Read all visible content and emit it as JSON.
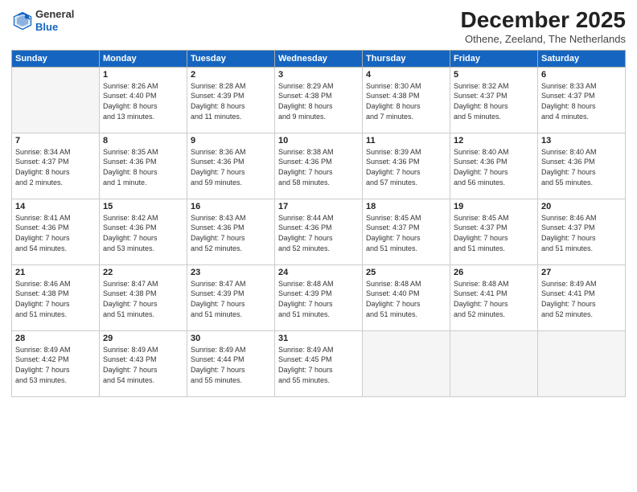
{
  "header": {
    "logo_line1": "General",
    "logo_line2": "Blue",
    "month": "December 2025",
    "location": "Othene, Zeeland, The Netherlands"
  },
  "days_of_week": [
    "Sunday",
    "Monday",
    "Tuesday",
    "Wednesday",
    "Thursday",
    "Friday",
    "Saturday"
  ],
  "weeks": [
    [
      {
        "day": "",
        "info": ""
      },
      {
        "day": "1",
        "info": "Sunrise: 8:26 AM\nSunset: 4:40 PM\nDaylight: 8 hours\nand 13 minutes."
      },
      {
        "day": "2",
        "info": "Sunrise: 8:28 AM\nSunset: 4:39 PM\nDaylight: 8 hours\nand 11 minutes."
      },
      {
        "day": "3",
        "info": "Sunrise: 8:29 AM\nSunset: 4:38 PM\nDaylight: 8 hours\nand 9 minutes."
      },
      {
        "day": "4",
        "info": "Sunrise: 8:30 AM\nSunset: 4:38 PM\nDaylight: 8 hours\nand 7 minutes."
      },
      {
        "day": "5",
        "info": "Sunrise: 8:32 AM\nSunset: 4:37 PM\nDaylight: 8 hours\nand 5 minutes."
      },
      {
        "day": "6",
        "info": "Sunrise: 8:33 AM\nSunset: 4:37 PM\nDaylight: 8 hours\nand 4 minutes."
      }
    ],
    [
      {
        "day": "7",
        "info": "Sunrise: 8:34 AM\nSunset: 4:37 PM\nDaylight: 8 hours\nand 2 minutes."
      },
      {
        "day": "8",
        "info": "Sunrise: 8:35 AM\nSunset: 4:36 PM\nDaylight: 8 hours\nand 1 minute."
      },
      {
        "day": "9",
        "info": "Sunrise: 8:36 AM\nSunset: 4:36 PM\nDaylight: 7 hours\nand 59 minutes."
      },
      {
        "day": "10",
        "info": "Sunrise: 8:38 AM\nSunset: 4:36 PM\nDaylight: 7 hours\nand 58 minutes."
      },
      {
        "day": "11",
        "info": "Sunrise: 8:39 AM\nSunset: 4:36 PM\nDaylight: 7 hours\nand 57 minutes."
      },
      {
        "day": "12",
        "info": "Sunrise: 8:40 AM\nSunset: 4:36 PM\nDaylight: 7 hours\nand 56 minutes."
      },
      {
        "day": "13",
        "info": "Sunrise: 8:40 AM\nSunset: 4:36 PM\nDaylight: 7 hours\nand 55 minutes."
      }
    ],
    [
      {
        "day": "14",
        "info": "Sunrise: 8:41 AM\nSunset: 4:36 PM\nDaylight: 7 hours\nand 54 minutes."
      },
      {
        "day": "15",
        "info": "Sunrise: 8:42 AM\nSunset: 4:36 PM\nDaylight: 7 hours\nand 53 minutes."
      },
      {
        "day": "16",
        "info": "Sunrise: 8:43 AM\nSunset: 4:36 PM\nDaylight: 7 hours\nand 52 minutes."
      },
      {
        "day": "17",
        "info": "Sunrise: 8:44 AM\nSunset: 4:36 PM\nDaylight: 7 hours\nand 52 minutes."
      },
      {
        "day": "18",
        "info": "Sunrise: 8:45 AM\nSunset: 4:37 PM\nDaylight: 7 hours\nand 51 minutes."
      },
      {
        "day": "19",
        "info": "Sunrise: 8:45 AM\nSunset: 4:37 PM\nDaylight: 7 hours\nand 51 minutes."
      },
      {
        "day": "20",
        "info": "Sunrise: 8:46 AM\nSunset: 4:37 PM\nDaylight: 7 hours\nand 51 minutes."
      }
    ],
    [
      {
        "day": "21",
        "info": "Sunrise: 8:46 AM\nSunset: 4:38 PM\nDaylight: 7 hours\nand 51 minutes."
      },
      {
        "day": "22",
        "info": "Sunrise: 8:47 AM\nSunset: 4:38 PM\nDaylight: 7 hours\nand 51 minutes."
      },
      {
        "day": "23",
        "info": "Sunrise: 8:47 AM\nSunset: 4:39 PM\nDaylight: 7 hours\nand 51 minutes."
      },
      {
        "day": "24",
        "info": "Sunrise: 8:48 AM\nSunset: 4:39 PM\nDaylight: 7 hours\nand 51 minutes."
      },
      {
        "day": "25",
        "info": "Sunrise: 8:48 AM\nSunset: 4:40 PM\nDaylight: 7 hours\nand 51 minutes."
      },
      {
        "day": "26",
        "info": "Sunrise: 8:48 AM\nSunset: 4:41 PM\nDaylight: 7 hours\nand 52 minutes."
      },
      {
        "day": "27",
        "info": "Sunrise: 8:49 AM\nSunset: 4:41 PM\nDaylight: 7 hours\nand 52 minutes."
      }
    ],
    [
      {
        "day": "28",
        "info": "Sunrise: 8:49 AM\nSunset: 4:42 PM\nDaylight: 7 hours\nand 53 minutes."
      },
      {
        "day": "29",
        "info": "Sunrise: 8:49 AM\nSunset: 4:43 PM\nDaylight: 7 hours\nand 54 minutes."
      },
      {
        "day": "30",
        "info": "Sunrise: 8:49 AM\nSunset: 4:44 PM\nDaylight: 7 hours\nand 55 minutes."
      },
      {
        "day": "31",
        "info": "Sunrise: 8:49 AM\nSunset: 4:45 PM\nDaylight: 7 hours\nand 55 minutes."
      },
      {
        "day": "",
        "info": ""
      },
      {
        "day": "",
        "info": ""
      },
      {
        "day": "",
        "info": ""
      }
    ]
  ]
}
